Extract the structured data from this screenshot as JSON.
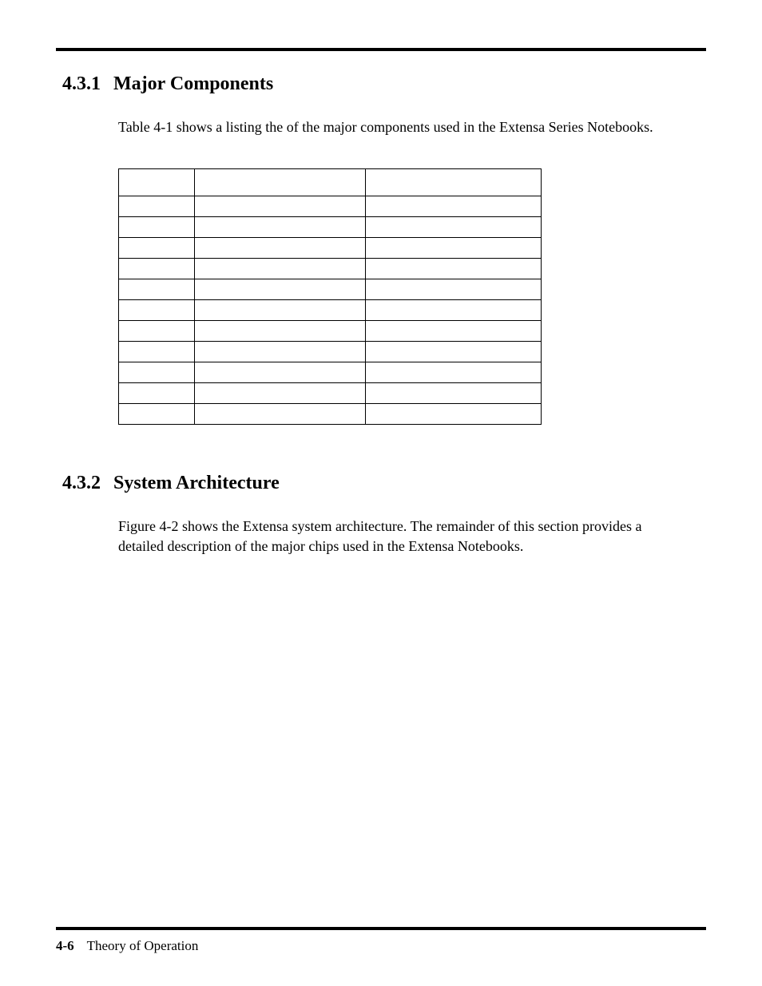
{
  "sections": {
    "s1": {
      "number": "4.3.1",
      "title": "Major Components",
      "para": "Table 4-1 shows a listing the of the major components used in the Extensa Series Notebooks."
    },
    "s2": {
      "number": "4.3.2",
      "title": "System Architecture",
      "para": "Figure 4-2 shows the Extensa system architecture. The remainder of this section provides a detailed description of the major chips used in the Extensa Notebooks."
    }
  },
  "footer": {
    "page": "4-6",
    "chapter": "Theory of Operation"
  }
}
